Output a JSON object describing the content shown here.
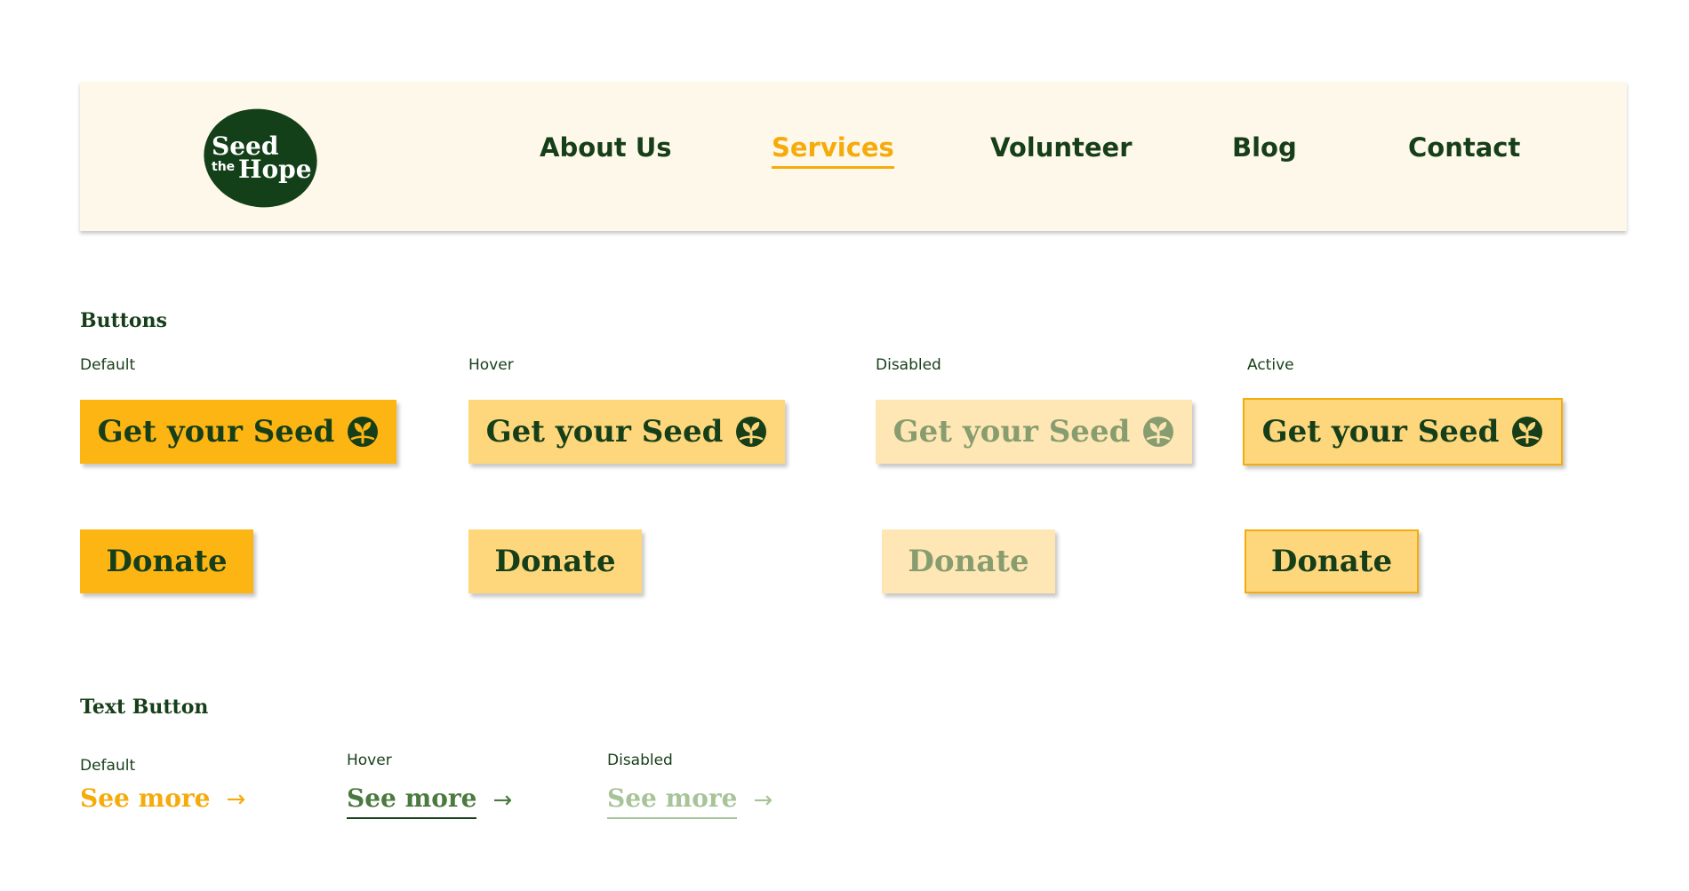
{
  "brand": {
    "logo_line1": "Seed",
    "logo_line2": "the",
    "logo_line3": "Hope",
    "logo_color": "#134019"
  },
  "nav": {
    "items": [
      {
        "label": "About Us",
        "active": false
      },
      {
        "label": "Services",
        "active": true
      },
      {
        "label": "Volunteer",
        "active": false
      },
      {
        "label": "Blog",
        "active": false
      },
      {
        "label": "Contact",
        "active": false
      }
    ],
    "active_color": "#f5ab0c"
  },
  "buttons_section": {
    "title": "Buttons",
    "states": [
      "Default",
      "Hover",
      "Disabled",
      "Active"
    ],
    "primary_label": "Get your Seed",
    "primary_icon": "seed-icon",
    "secondary_label": "Donate",
    "colors": {
      "default": "#fdb513",
      "hover": "#fed77c",
      "disabled": "#fee7b4",
      "active": "#fed77c",
      "active_border": "#f5ab0c",
      "text": "#163f19",
      "disabled_text": "#879d70"
    }
  },
  "text_button_section": {
    "title": "Text Button",
    "states": [
      "Default",
      "Hover",
      "Disabled"
    ],
    "label": "See more",
    "icon": "arrow-right-icon",
    "arrow": "→",
    "colors": {
      "default": "#f5ab0c",
      "hover": "#4a7a3e",
      "disabled": "#a7c398"
    }
  }
}
